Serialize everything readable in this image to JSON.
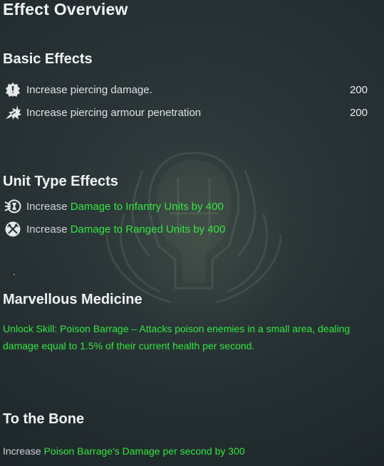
{
  "title": "Effect Overview",
  "basic_effects": {
    "heading": "Basic Effects",
    "items": [
      {
        "icon": "piercing-damage-icon",
        "label": "Increase piercing damage.",
        "value": "200"
      },
      {
        "icon": "armour-penetration-icon",
        "label": "Increase piercing armour penetration",
        "value": "200"
      }
    ]
  },
  "unit_type_effects": {
    "heading": "Unit Type Effects",
    "items": [
      {
        "icon": "infantry-damage-icon",
        "prefix": "Increase ",
        "highlight": "Damage to Infantry Units by 400"
      },
      {
        "icon": "ranged-damage-icon",
        "prefix": "Increase ",
        "highlight": "Damage to Ranged Units by 400"
      }
    ]
  },
  "marvellous_medicine": {
    "heading": "Marvellous Medicine",
    "description": "Unlock Skill: Poison Barrage – Attacks poison enemies in a small area, dealing damage equal to 1.5% of their current health per second."
  },
  "to_the_bone": {
    "heading": "To the Bone",
    "prefix": "Increase ",
    "highlight": "Poison Barrage's Damage per second by 300"
  },
  "colors": {
    "highlight": "#33e63f",
    "heading": "#f1f3f5",
    "spark": "#e08a2e"
  }
}
